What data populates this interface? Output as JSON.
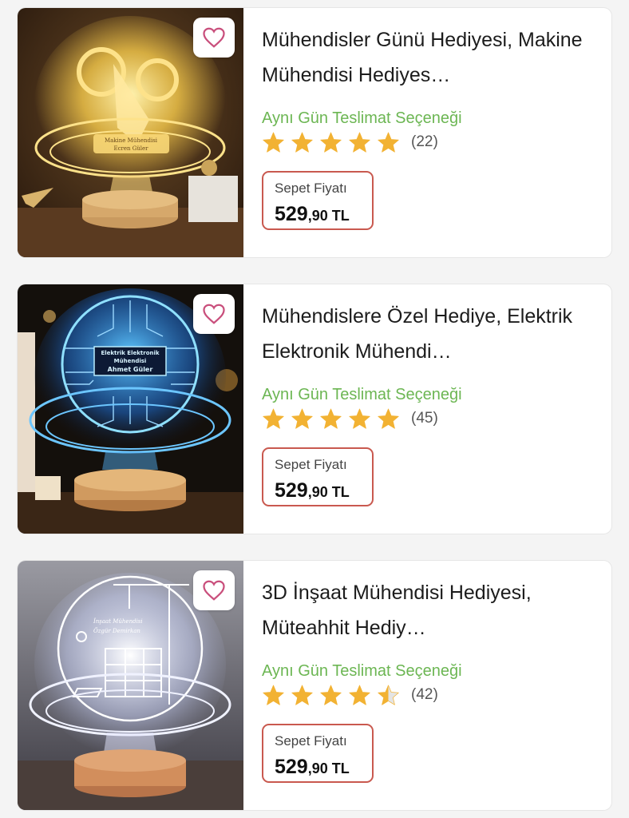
{
  "products": [
    {
      "title": "Mühendisler Günü Hediyesi, Makine Mühendisi Hediyes…",
      "delivery": "Aynı Gün Teslimat Seçeneği",
      "rating": 5,
      "review_count": "(22)",
      "price_label": "Sepet Fiyatı",
      "price_main": "529",
      "price_decimal": ",90 TL",
      "image_text": [
        "Makine Mühendisi",
        "Ecren Güler"
      ]
    },
    {
      "title": "Mühendislere Özel Hediye, Elektrik Elektronik Mühendi…",
      "delivery": "Aynı Gün Teslimat Seçeneği",
      "rating": 5,
      "review_count": "(45)",
      "price_label": "Sepet Fiyatı",
      "price_main": "529",
      "price_decimal": ",90 TL",
      "image_text": [
        "Elektrik Elektronik",
        "Mühendisi",
        "Ahmet Güler"
      ]
    },
    {
      "title": "3D İnşaat Mühendisi Hediyesi, Müteahhit Hediy…",
      "delivery": "Aynı Gün Teslimat Seçeneği",
      "rating": 4.5,
      "review_count": "(42)",
      "price_label": "Sepet Fiyatı",
      "price_main": "529",
      "price_decimal": ",90 TL",
      "image_text": [
        "İnşaat Mühendisi",
        "Özgür Demirkan"
      ]
    }
  ],
  "colors": {
    "delivery_green": "#6cb653",
    "star_gold": "#f2b233",
    "price_border": "#c9594f",
    "heart_pink": "#c94f7c"
  },
  "icons": {
    "favorite": "heart-outline-icon",
    "star": "star-icon"
  }
}
